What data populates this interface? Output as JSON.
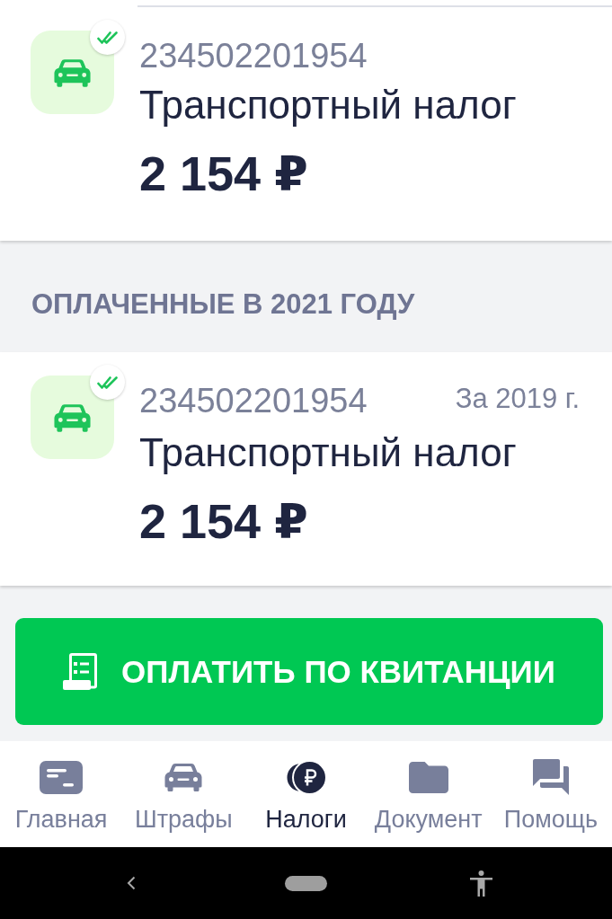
{
  "payments": [
    {
      "number": "234502201954",
      "title": "Транспортный налог",
      "amount": "2 154 ₽",
      "paid": true
    }
  ],
  "paid_section": {
    "heading": "ОПЛАЧЕННЫЕ В 2021 ГОДУ",
    "payments": [
      {
        "number": "234502201954",
        "period": "За 2019 г.",
        "title": "Транспортный налог",
        "amount": "2 154 ₽",
        "paid": true
      }
    ]
  },
  "pay_button": {
    "label": "ОПЛАТИТЬ ПО КВИТАНЦИИ"
  },
  "bottom_nav": [
    {
      "label": "Главная",
      "selected": false
    },
    {
      "label": "Штрафы",
      "selected": false
    },
    {
      "label": "Налоги",
      "selected": true
    },
    {
      "label": "Документ",
      "selected": false
    },
    {
      "label": "Помощь",
      "selected": false
    }
  ]
}
